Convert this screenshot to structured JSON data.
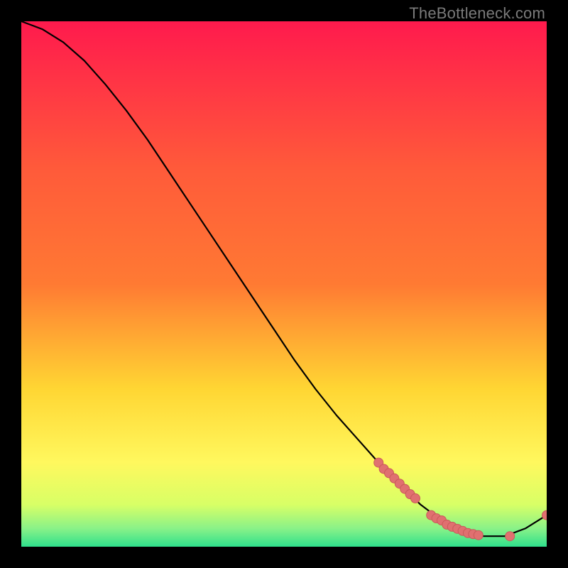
{
  "watermark": "TheBottleneck.com",
  "colors": {
    "background": "#000000",
    "gradient_top": "#ff1a4d",
    "gradient_mid1": "#ff7a33",
    "gradient_mid2": "#ffd633",
    "gradient_mid3": "#fff85e",
    "gradient_bottom": "#2fe08c",
    "curve": "#000000",
    "dot_fill": "#e07070",
    "dot_stroke": "#c95a5a"
  },
  "chart_data": {
    "type": "line",
    "title": "",
    "xlabel": "",
    "ylabel": "",
    "xlim": [
      0,
      100
    ],
    "ylim": [
      0,
      100
    ],
    "curve": {
      "x": [
        0,
        4,
        8,
        12,
        16,
        20,
        24,
        28,
        32,
        36,
        40,
        44,
        48,
        52,
        56,
        60,
        64,
        68,
        72,
        76,
        80,
        84,
        88,
        92,
        96,
        100
      ],
      "y": [
        100,
        98.5,
        96,
        92.5,
        88,
        83,
        77.5,
        71.5,
        65.5,
        59.5,
        53.5,
        47.5,
        41.5,
        35.5,
        30,
        25,
        20.5,
        16,
        12,
        8,
        5,
        3,
        2,
        2,
        3.5,
        6
      ]
    },
    "dots": {
      "x": [
        68,
        69,
        70,
        71,
        72,
        73,
        74,
        75,
        78,
        79,
        80,
        81,
        82,
        83,
        84,
        85,
        86,
        87,
        93,
        100
      ],
      "y": [
        16,
        14.8,
        14,
        13,
        12,
        11,
        10,
        9.2,
        6,
        5.4,
        5,
        4.2,
        3.8,
        3.4,
        3,
        2.6,
        2.4,
        2.2,
        2,
        6
      ]
    },
    "legend": null
  }
}
